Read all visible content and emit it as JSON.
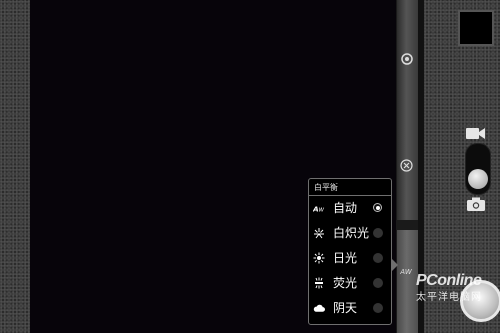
{
  "white_balance_menu": {
    "title": "白平衡",
    "items": [
      {
        "label": "自动",
        "icon": "auto-wb-icon",
        "selected": true
      },
      {
        "label": "白炽光",
        "icon": "incandescent-icon",
        "selected": false
      },
      {
        "label": "日光",
        "icon": "daylight-icon",
        "selected": false
      },
      {
        "label": "荧光",
        "icon": "fluorescent-icon",
        "selected": false
      },
      {
        "label": "阴天",
        "icon": "cloudy-icon",
        "selected": false
      }
    ]
  },
  "settings_bar": {
    "icons": [
      "settings-icon",
      "flash-icon",
      "auto-wb-icon"
    ],
    "wb_label": "AW"
  },
  "watermark": {
    "main": "PConline",
    "sub": "太平洋电脑网"
  },
  "colors": {
    "popup_border": "#6f6f6f",
    "panel_texture": "#3b3b3b",
    "viewfinder": "#07040a"
  }
}
